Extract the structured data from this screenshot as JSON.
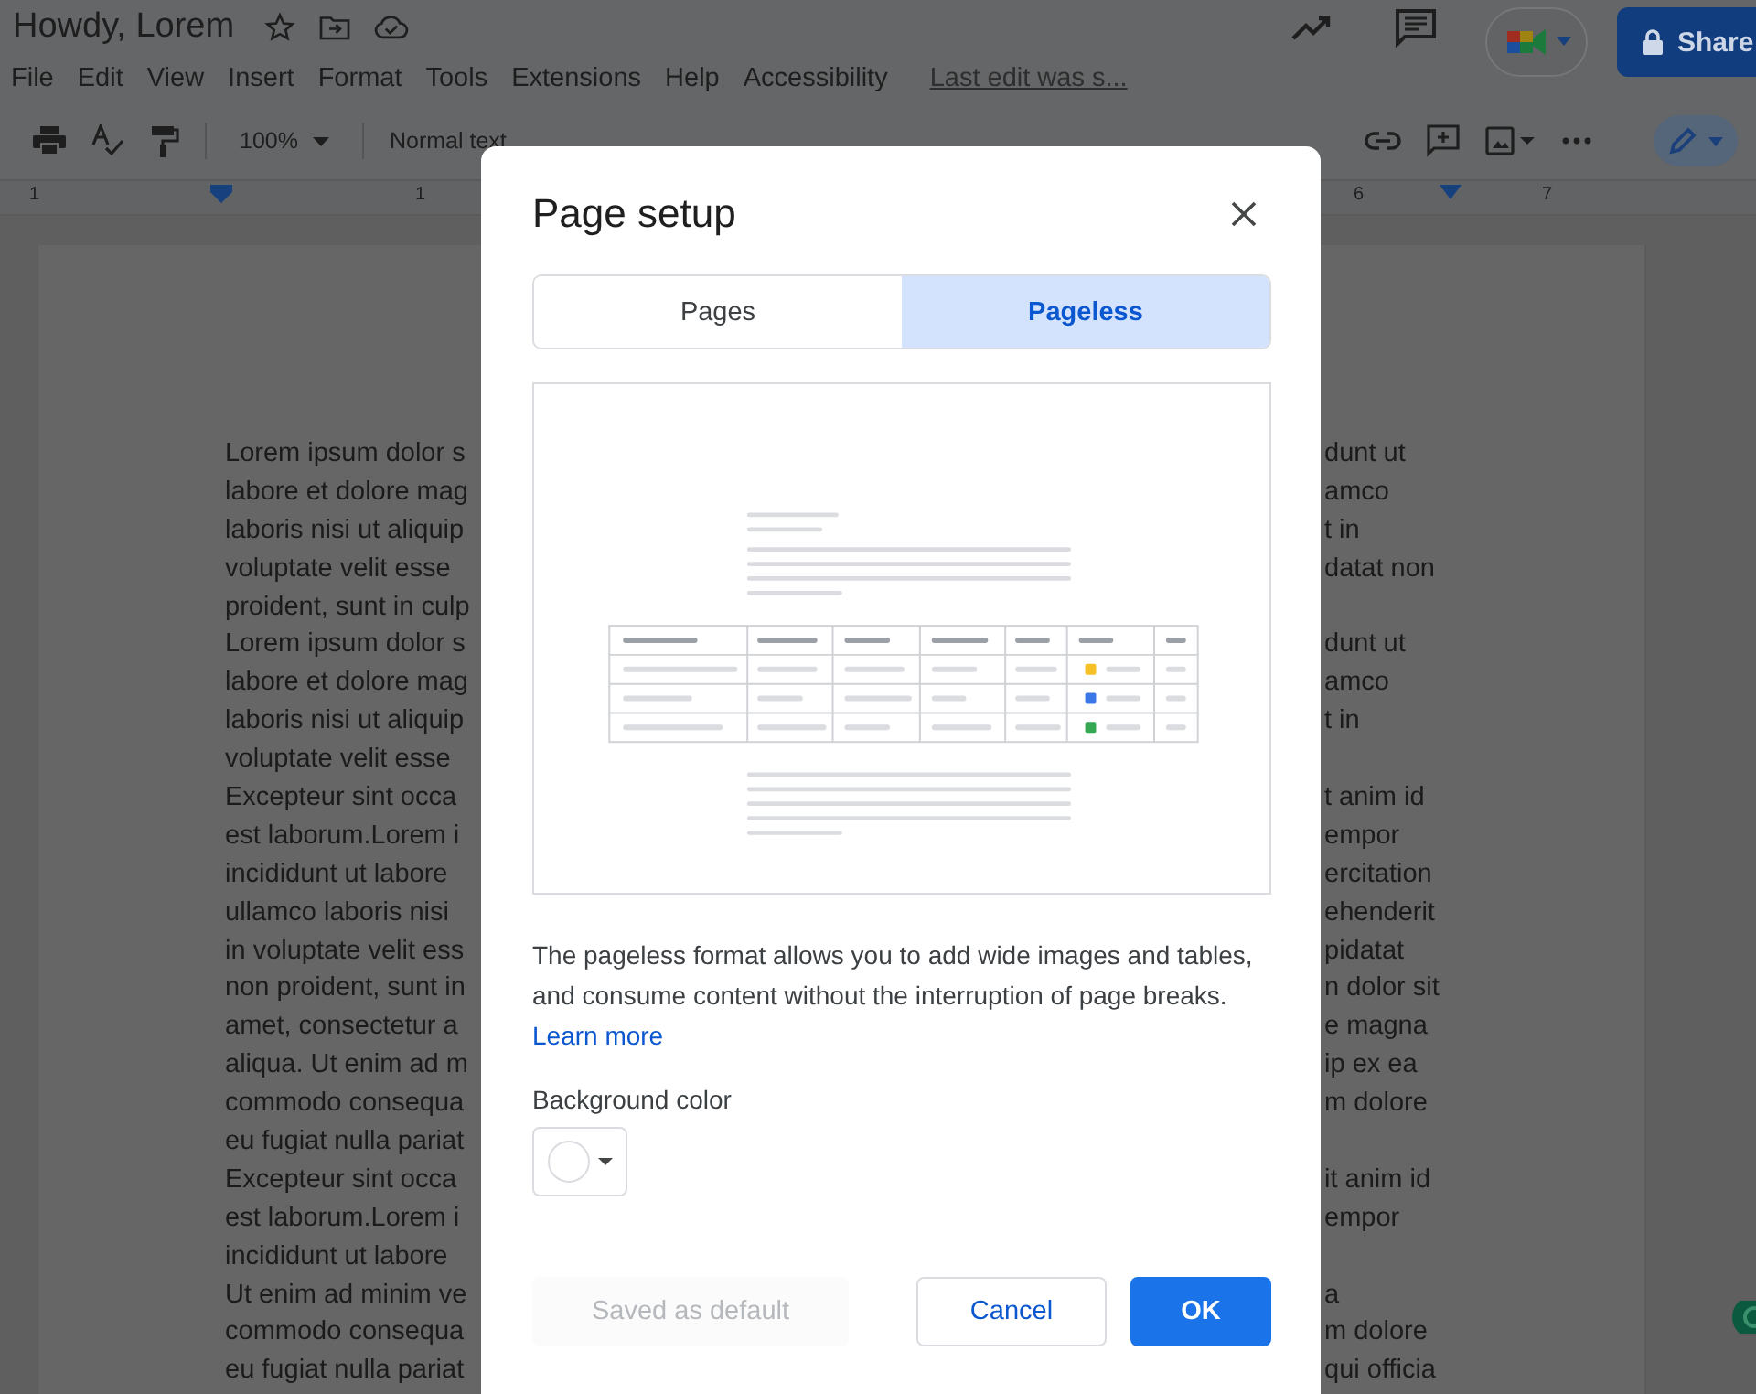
{
  "header": {
    "title": "Howdy, Lorem",
    "share_label": "Share"
  },
  "menu": {
    "items": [
      "File",
      "Edit",
      "View",
      "Insert",
      "Format",
      "Tools",
      "Extensions",
      "Help",
      "Accessibility"
    ],
    "last_edit": "Last edit was s..."
  },
  "toolbar": {
    "zoom": "100%",
    "style": "Normal text"
  },
  "ruler": {
    "labels": [
      "1",
      "1",
      "6",
      "7"
    ]
  },
  "document": {
    "lines": [
      {
        "left": "Lorem ipsum dolor s",
        "right": "dunt ut"
      },
      {
        "left": "labore et dolore mag",
        "right": "amco"
      },
      {
        "left": "laboris nisi ut aliquip",
        "right": "t in"
      },
      {
        "left": "voluptate velit esse",
        "right": "datat non"
      },
      {
        "left": "proident, sunt in culp"
      },
      {
        "left": "Lorem ipsum dolor s",
        "right": "dunt ut"
      },
      {
        "left": "labore et dolore mag",
        "right": "amco"
      },
      {
        "left": "laboris nisi ut aliquip",
        "right": "t in"
      },
      {
        "left": "voluptate velit esse"
      },
      {
        "left": "Excepteur sint occa",
        "right": "t anim id"
      },
      {
        "left": "est laborum.Lorem i",
        "right": "empor"
      },
      {
        "left": "incididunt ut labore",
        "right": "ercitation"
      },
      {
        "left": "ullamco laboris nisi",
        "right": "ehenderit"
      },
      {
        "left": "in voluptate velit ess",
        "right": "pidatat"
      },
      {
        "left": "non proident, sunt in",
        "right": "n dolor sit"
      },
      {
        "left": "amet, consectetur a",
        "right": "e magna"
      },
      {
        "left": "aliqua. Ut enim ad m",
        "right": "ip ex ea"
      },
      {
        "left": "commodo consequa",
        "right": "m dolore"
      },
      {
        "left": "eu fugiat nulla pariat"
      },
      {
        "left": "Excepteur sint occa",
        "right": "it anim id"
      },
      {
        "left": "est laborum.Lorem i",
        "right": "empor"
      },
      {
        "left": "incididunt ut labore"
      },
      {
        "left": "Ut enim ad minim ve",
        "right": "a"
      },
      {
        "left": "commodo consequa",
        "right": "m dolore"
      },
      {
        "left": "eu fugiat nulla pariat",
        "right": "qui officia"
      }
    ]
  },
  "dialog": {
    "title": "Page setup",
    "tabs": [
      {
        "label": "Pages",
        "selected": false
      },
      {
        "label": "Pageless",
        "selected": true
      }
    ],
    "description": "The pageless format allows you to add wide images and tables, and consume content without the interruption of page breaks.",
    "learn_more": "Learn more",
    "background_label": "Background color",
    "buttons": [
      {
        "label": "Saved as default",
        "kind": "tertiary",
        "disabled": true
      },
      {
        "label": "Cancel",
        "kind": "secondary",
        "disabled": false
      },
      {
        "label": "OK",
        "kind": "primary",
        "disabled": false
      }
    ]
  }
}
